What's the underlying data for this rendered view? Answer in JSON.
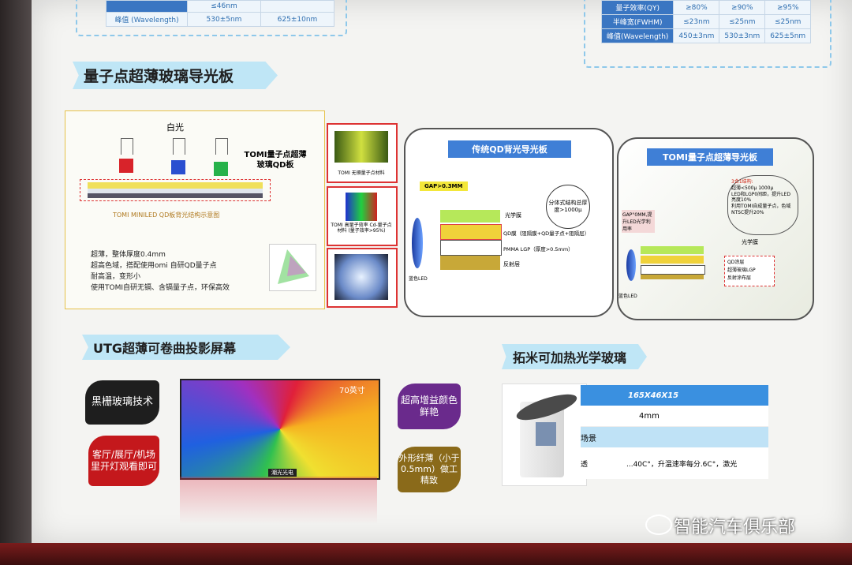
{
  "top_left_table": {
    "row_label": "峰值 (Wavelength)",
    "col1_partial": "≤46nm",
    "col1": "530±5nm",
    "col2": "625±10nm"
  },
  "top_right_table": {
    "rows": [
      {
        "label": "量子效率(QY)",
        "c1": "≥80%",
        "c2": "≥90%",
        "c3": "≥95%"
      },
      {
        "label": "半峰宽(FWHM)",
        "c1": "≤23nm",
        "c2": "≤25nm",
        "c3": "≤25nm"
      },
      {
        "label": "峰值(Wavelength)",
        "c1": "450±3nm",
        "c2": "530±3nm",
        "c3": "625±5nm"
      }
    ]
  },
  "section_qd": {
    "title": "量子点超薄玻璃导光板",
    "white_light": "白光",
    "callout": "TOMI量子点超薄玻璃QD板",
    "diagram_caption": "TOMI MINILED QD板背光结构示意图",
    "features": [
      "超薄，整体厚度0.4mm",
      "超高色域，搭配使用omi 自研QD量子点",
      "耐高温，变形小",
      "使用TOMI自研无镉、含镉量子点，环保高效"
    ],
    "photos": [
      {
        "caption": "TOMI 无镉量子点材料"
      },
      {
        "caption": "TOMI 高量子效率 Cd-量子点材料 (量子效率>95%)"
      },
      {
        "caption": ""
      }
    ],
    "traditional": {
      "title": "传统QD背光导光板",
      "gap": "GAP>0.3MM",
      "split_note": "分体式结构总厚度>1000μ",
      "layers": [
        "光学膜",
        "QD膜（阻隔膜+QD量子点+阻隔层）",
        "PMMA LGP（厚度>0.5mm）",
        "反射层"
      ],
      "led_label": "蓝色LED"
    },
    "tomi": {
      "title": "TOMI量子点超薄导光板",
      "gap": "GAP°0MM,提升LED光学利用率",
      "features_head": "3合1结构:",
      "features": [
        "超薄<500μ 1000μ",
        "LED和LGP0间距，提升LED亮度10%",
        "利用TOMI自成量子点，色域NTSC提升20%"
      ],
      "optical_film": "光学膜",
      "stack_labels": [
        "QD涂层",
        "超薄玻璃LGP",
        "反射涂布层"
      ],
      "led_label": "蓝色LED"
    }
  },
  "section_utg": {
    "title": "UTG超薄可卷曲投影屏幕",
    "left_badges": [
      "黑栅玻璃技术",
      "客厅/展厅/机场里开灯观看即可"
    ],
    "screen_size": "70英寸",
    "right_badges": [
      "超高增益颜色鲜艳",
      "外形纤薄（小于0.5mm）做工精致"
    ],
    "logo_text": "潮光光电"
  },
  "section_heat": {
    "title": "拓米可加热光学玻璃",
    "spec_rows": [
      {
        "label": "",
        "value": "165X46X15"
      },
      {
        "label": "",
        "value": "4mm"
      },
      {
        "label": "场景",
        "value": ""
      },
      {
        "label": "透",
        "value": "...40C°，升温速率每分.6C°，激光"
      }
    ]
  },
  "watermark": "智能汽车俱乐部",
  "colors": {
    "accent_blue": "#3f7fd6",
    "title_bg": "#bfe6f6",
    "badge_black": "#1e1e1e",
    "badge_red": "#c4181c",
    "badge_purple": "#6a2a8c",
    "badge_olive": "#8a6a1a"
  }
}
